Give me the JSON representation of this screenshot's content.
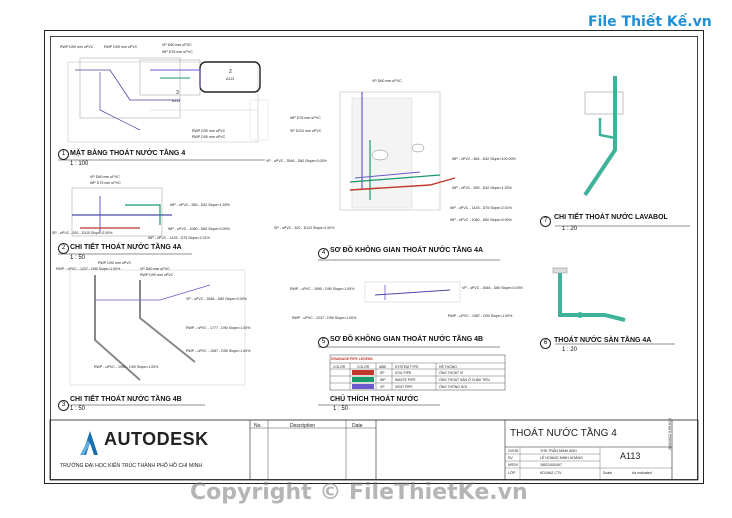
{
  "brand": {
    "text": "File Thiết Kế.vn"
  },
  "watermark": {
    "text": "Copyright © FileThietKe.vn"
  },
  "views": [
    {
      "num": "1",
      "title": "MẶT BẰNG THOÁT NƯỚC TẦNG 4",
      "scale": "1 : 100"
    },
    {
      "num": "2",
      "title": "CHI TIẾT THOÁT NƯỚC TẦNG 4A",
      "scale": "1 : 50"
    },
    {
      "num": "3",
      "title": "CHI TIẾT THOÁT NƯỚC TẦNG 4B",
      "scale": "1 : 50"
    },
    {
      "num": "4",
      "title": "SƠ ĐỒ KHÔNG GIAN THOÁT NƯỚC TẦNG 4A",
      "scale": ""
    },
    {
      "num": "5",
      "title": "SƠ ĐỒ KHÔNG GIAN THOÁT NƯỚC TẦNG 4B",
      "scale": ""
    },
    {
      "num": "6",
      "title": "THOÁT NƯỚC SÀN TẦNG 4A",
      "scale": "1 : 20"
    },
    {
      "num": "7",
      "title": "CHI TIẾT THOÁT NƯỚC LAVABOL",
      "scale": "1 : 20"
    },
    {
      "num": "",
      "title": "CHÚ THÍCH THOÁT NƯỚC",
      "scale": "1 : 50"
    }
  ],
  "pipe_labels": {
    "v1": [
      "RWP D90 mm uPVC",
      "RWP D90 mm uPVC",
      "VP D60 mm uPVC",
      "WP D75 mm uPVC",
      "RWP D90 mm uPVC",
      "RWP D90 mm uPVC"
    ],
    "v1_tags": [
      "2",
      "A113",
      "3",
      "A113"
    ],
    "v2": [
      "VP D60 mm uPVC",
      "WP D75 mm uPVC",
      "WP - uPVC - 559 - D42 Slope=1.53%",
      "SP - uPVC - 520 - D110 Slope=2.00%",
      "WP - uPVC - 1080 - D60 Slope=0.00%",
      "WP - uPVC - 1425 - D75 Slope=2.01%"
    ],
    "v3": [
      "RWP D90 mm uPVC",
      "RWP - uPVC - 1237 - D90 Slope=1.00%",
      "VP D60 mm uPVC",
      "RWP D90 mm uPVC",
      "VP - uPVC - 3546 - D60 Slope=0.00%",
      "RWP - uPVC - 1777 - D90 Slope=1.00%",
      "RWP - uPVC - 1087 - D90 Slope=1.00%",
      "RWP - uPVC - 1990 - D90 Slope=1.00%"
    ],
    "v4": [
      "VP D60 mm uPVC",
      "WP D75 mm uPVC",
      "SP D110 mm uPVC",
      "VP - uPVC - 3546 - D60 Slope=0.00%",
      "WP - uPVC - 664 - D42 Slope=100.00%",
      "WP - uPVC - 559 - D42 Slope=1.53%",
      "WP - uPVC - 1425 - D75 Slope=2.01%",
      "WP - uPVC - 1080 - D60 Slope=0.00%",
      "SP - uPVC - 520 - D110 Slope=2.00%"
    ],
    "v5": [
      "RWP - uPVC - 1990 - D90 Slope=1.00%",
      "VP - uPVC - 3546 - D60 Slope=0.00%",
      "RWP - uPVC - 1237 - D90 Slope=1.00%",
      "RWP - uPVC - 1087 - D90 Slope=1.00%"
    ]
  },
  "legend": {
    "title": "DRAINAGE PIPE LEGEND",
    "headers": [
      "COLOR",
      "COLOR",
      "ABB",
      "SYSTEM TYPE",
      "HỆ THỐNG"
    ],
    "rows": [
      {
        "abb": "SP",
        "system": "SOIL PIPE",
        "vn": "ỐNG THOÁT XÍ",
        "color": "#c0392b"
      },
      {
        "abb": "WP",
        "system": "WASTE PIPE",
        "vn": "ỐNG THOÁT SÀN Ở CHẬU TIỂU",
        "color": "#1a9a6a"
      },
      {
        "abb": "VP",
        "system": "VENT PIPE",
        "vn": "ỐNG THÔNG HƠI",
        "color": "#6a5acd"
      }
    ]
  },
  "colors": {
    "soil": "#c0392b",
    "waste": "#1a9a6a",
    "vent": "#6a5acd",
    "rain": "#4a4aa8",
    "lav": "#3fb39a"
  },
  "title_block": {
    "logo": "AUTODESK",
    "school": "TRƯỜNG ĐẠI HỌC KIẾN TRÚC THÀNH PHỐ HỒ CHÍ MINH",
    "rev_headers": [
      "No.",
      "Description",
      "Date"
    ],
    "sheet_title": "THOÁT NƯỚC TẦNG 4",
    "rows": [
      {
        "k": "GVHD",
        "v": "THS.TRẦN MINH ANH"
      },
      {
        "k": "SV",
        "v": "LÊ HOÀNG MINH HOÀNG"
      },
      {
        "k": "MSSV",
        "v": "18521000497"
      },
      {
        "k": "LỚP",
        "v": "KD19A2 CTV"
      }
    ],
    "sheet_no": "A113",
    "scale_label": "Scale",
    "scale_value": "As indicated",
    "date_vertical": "28/8/2022 9:59:01 1"
  }
}
